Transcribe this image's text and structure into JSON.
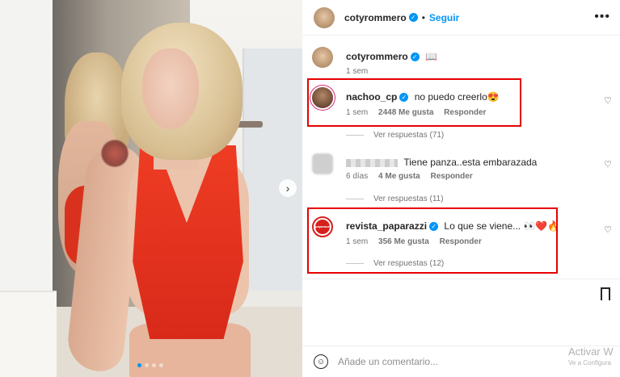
{
  "post": {
    "author": "cotyrommero",
    "follow_label": "Seguir",
    "more_icon": "more-options-icon",
    "caption": {
      "user": "cotyrommero",
      "emoji": "📖",
      "time": "1 sem"
    }
  },
  "comments": [
    {
      "user": "nachoo_cp",
      "text": "no puedo creerlo😍",
      "time": "1 sem",
      "likes": "2448 Me gusta",
      "reply": "Responder",
      "view_replies": "Ver respuestas (71)"
    },
    {
      "user": "",
      "text": "Tiene panza..esta embarazada",
      "time": "6 días",
      "likes": "4 Me gusta",
      "reply": "Responder",
      "view_replies": "Ver respuestas (11)"
    },
    {
      "user": "revista_paparazzi",
      "text": "Lo que se viene... 👀❤️🔥",
      "time": "1 sem",
      "likes": "356 Me gusta",
      "reply": "Responder",
      "view_replies": "Ver respuestas (12)"
    }
  ],
  "composer": {
    "placeholder": "Añade un comentario..."
  },
  "watermark": {
    "title": "Activar W",
    "subtitle": "Ve a Configura"
  },
  "colors": {
    "accent": "#0095f6",
    "highlight": "#e60000"
  },
  "carousel": {
    "slides": 4,
    "active": 1
  }
}
